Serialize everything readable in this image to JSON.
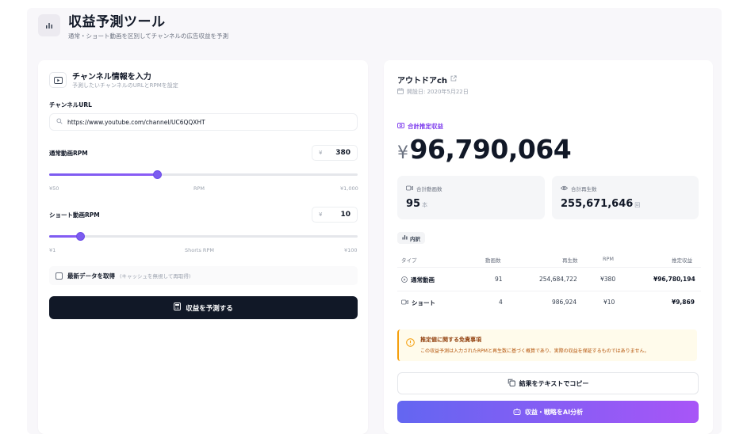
{
  "header": {
    "title": "収益予測ツール",
    "subtitle": "通常・ショート動画を区別してチャンネルの広告収益を予測"
  },
  "form": {
    "title": "チャンネル情報を入力",
    "subtitle": "予測したいチャンネルのURLとRPMを設定",
    "url_label": "チャンネルURL",
    "url_value": "https://www.youtube.com/channel/UC6QQXHT",
    "normal_rpm_label": "通常動画RPM",
    "normal_rpm_currency": "¥",
    "normal_rpm_value": "380",
    "normal_slider": {
      "min_label": "¥50",
      "mid_label": "RPM",
      "max_label": "¥1,000",
      "level": 0.35
    },
    "shorts_rpm_label": "ショート動画RPM",
    "shorts_rpm_currency": "¥",
    "shorts_rpm_value": "10",
    "shorts_slider": {
      "min_label": "¥1",
      "mid_label": "Shorts RPM",
      "max_label": "¥100",
      "level": 0.1
    },
    "cache_label": "最新データを取得",
    "cache_note": "(キャッシュを無視して再取得)",
    "submit_label": "収益を予測する"
  },
  "result": {
    "channel_name": "アウトドアch",
    "opened_date": "開設日: 2020年5月22日",
    "total_label": "合計推定収益",
    "total_currency": "¥",
    "total_value": "96,790,064",
    "stats": {
      "videos_label": "合計動画数",
      "videos_value": "95",
      "videos_unit": "本",
      "views_label": "合計再生数",
      "views_value": "255,671,646",
      "views_unit": "回"
    },
    "breakdown_label": "内訳",
    "table": {
      "headers": [
        "タイプ",
        "動画数",
        "再生数",
        "RPM",
        "推定収益"
      ],
      "rows": [
        {
          "type": "通常動画",
          "count": "91",
          "views": "254,684,722",
          "rpm": "¥380",
          "revenue": "¥96,780,194"
        },
        {
          "type": "ショート",
          "count": "4",
          "views": "986,924",
          "rpm": "¥10",
          "revenue": "¥9,869"
        }
      ]
    },
    "disclaimer_title": "推定値に関する免責事項",
    "disclaimer_body": "この収益予測は入力されたRPMと再生数に基づく概算であり、実際の収益を保証するものではありません。",
    "copy_label": "結果をテキストでコピー",
    "ai_label": "収益・戦略をAI分析"
  },
  "colors": {
    "accent": "#7c5cf0",
    "dark_button": "#111827",
    "ai_gradient_start": "#6366f1",
    "ai_gradient_end": "#a855f7",
    "warning": "#f59e0b"
  }
}
